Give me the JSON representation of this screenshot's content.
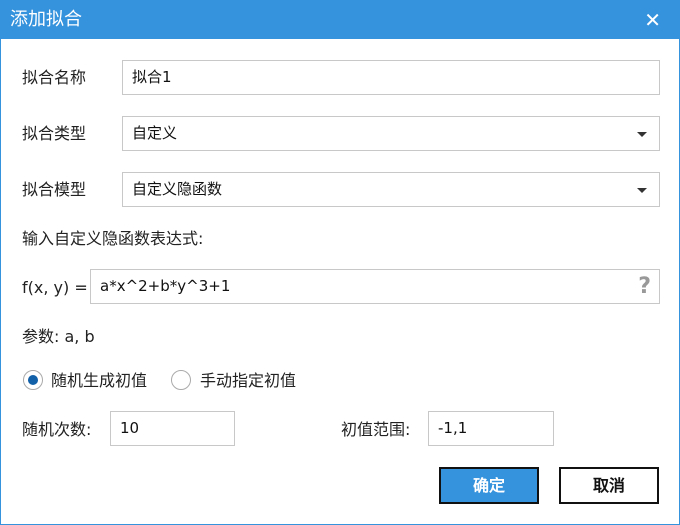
{
  "title": "添加拟合",
  "close_icon": "close-icon",
  "fit_name": {
    "label": "拟合名称",
    "value": "拟合1"
  },
  "fit_type": {
    "label": "拟合类型",
    "value": "自定义"
  },
  "fit_model": {
    "label": "拟合模型",
    "value": "自定义隐函数"
  },
  "expr_prompt": "输入自定义隐函数表达式:",
  "expr": {
    "label": "f(x, y) =",
    "value": "a*x^2+b*y^3+1",
    "help": "?"
  },
  "params": {
    "label": "参数:",
    "value": "a, b"
  },
  "init_mode": {
    "options": [
      {
        "label": "随机生成初值",
        "selected": true
      },
      {
        "label": "手动指定初值",
        "selected": false
      }
    ]
  },
  "random_count": {
    "label": "随机次数:",
    "value": "10"
  },
  "init_range": {
    "label": "初值范围:",
    "value": "-1,1"
  },
  "buttons": {
    "ok": "确定",
    "cancel": "取消"
  }
}
